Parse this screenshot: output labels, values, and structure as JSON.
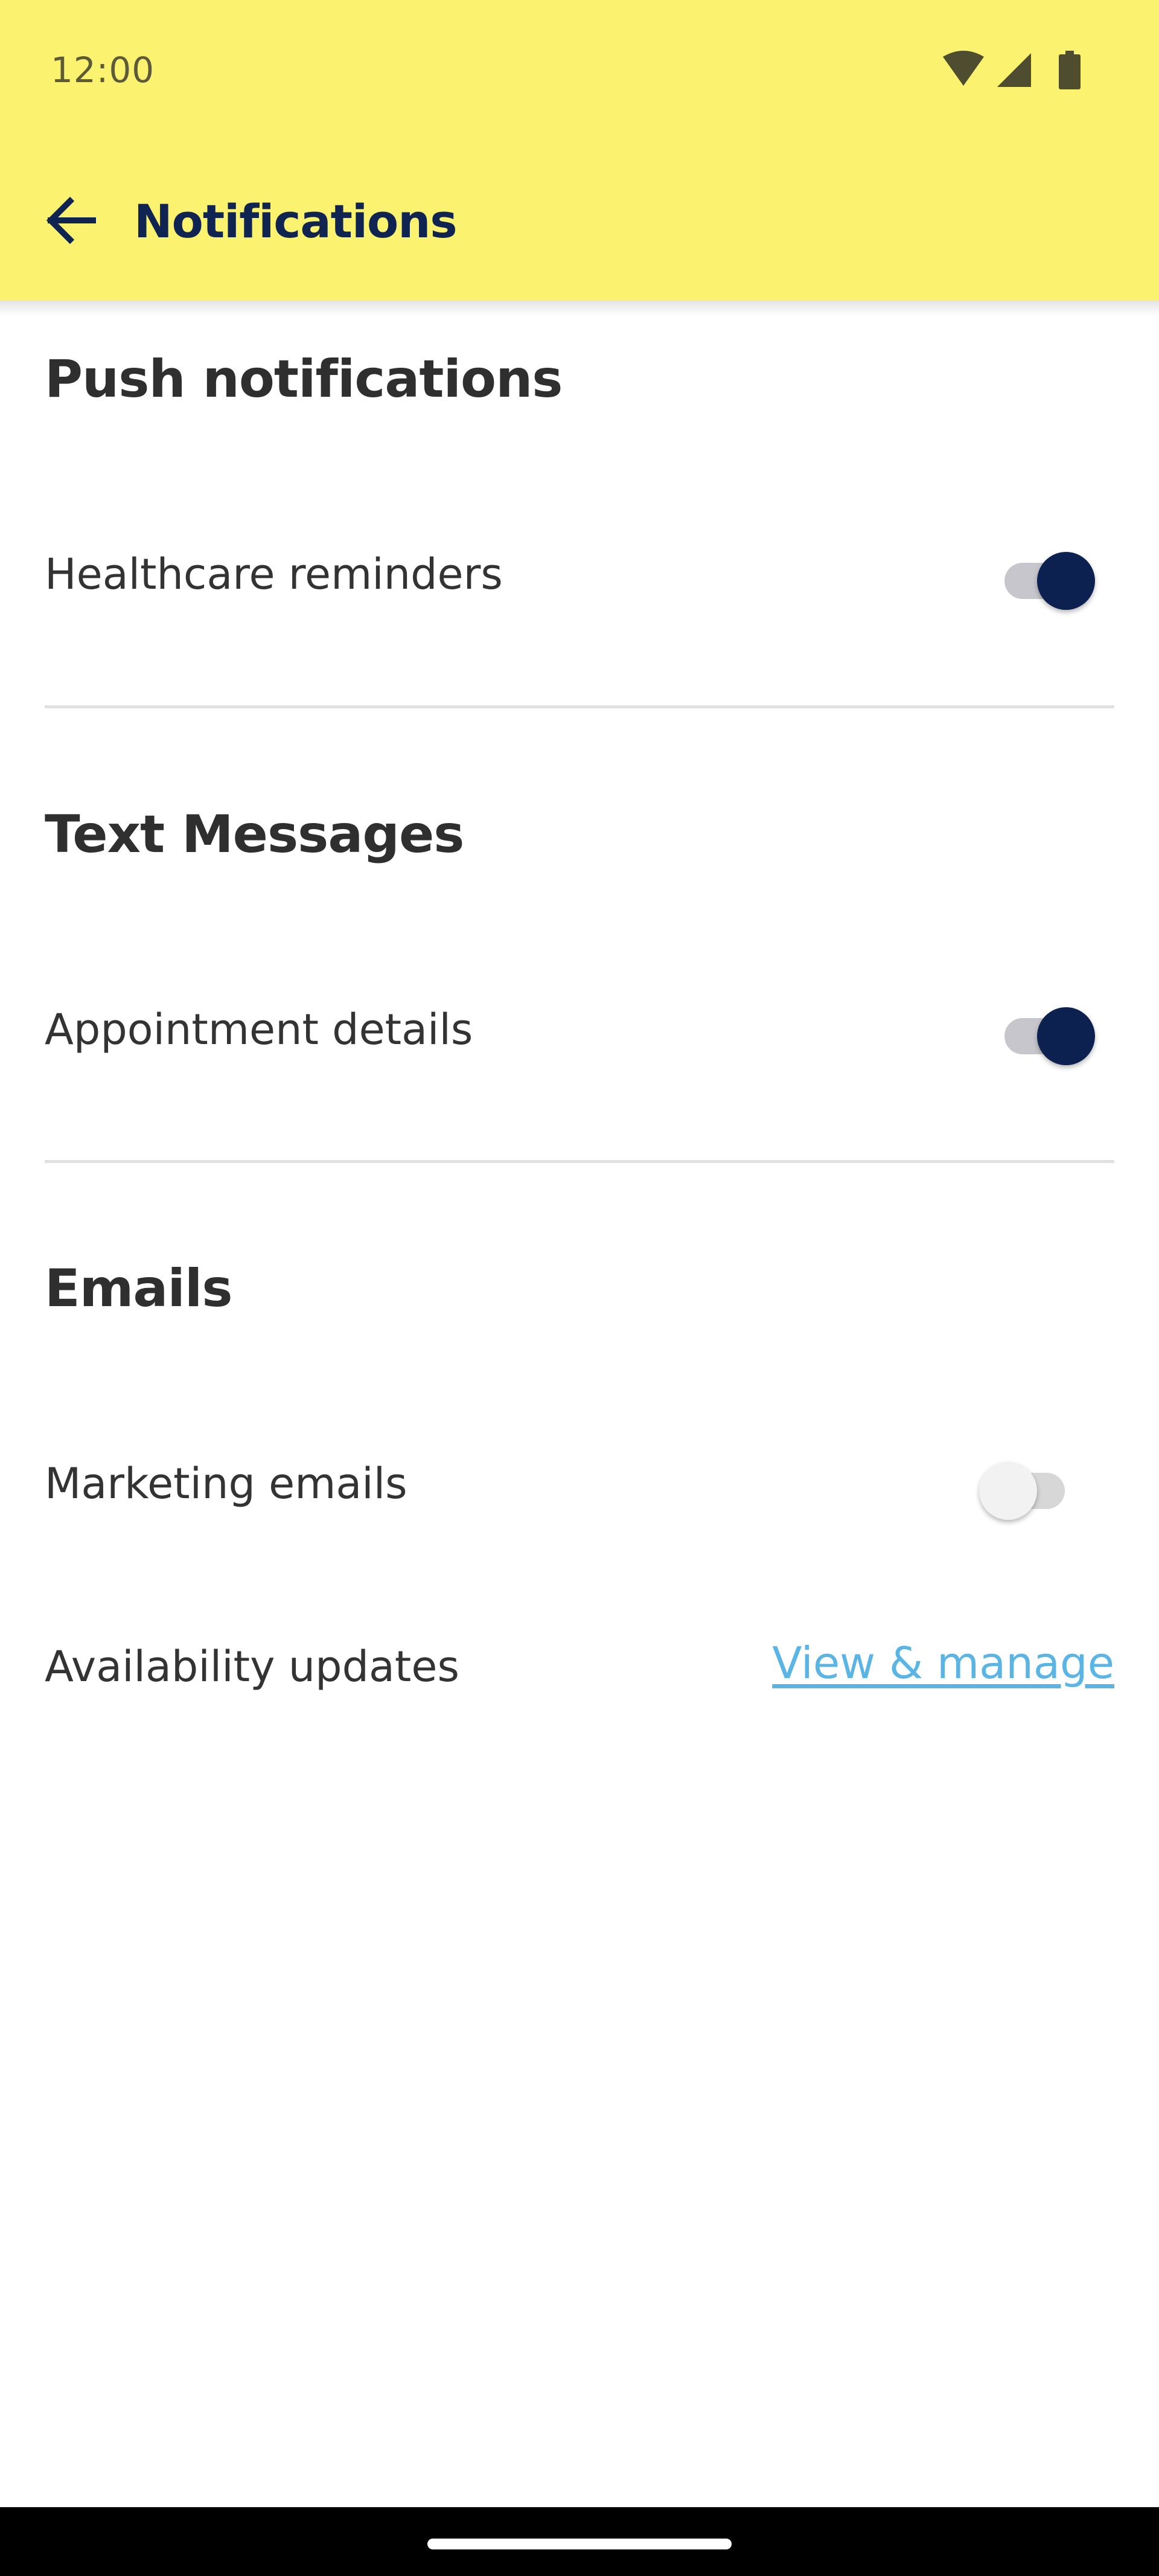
{
  "status_bar": {
    "time": "12:00",
    "icons": [
      "wifi-icon",
      "cellular-signal-icon",
      "battery-icon"
    ]
  },
  "header": {
    "title": "Notifications",
    "back_icon": "arrow-left-icon"
  },
  "sections": [
    {
      "title": "Push notifications",
      "rows": [
        {
          "label": "Healthcare reminders",
          "control": "toggle",
          "enabled": true
        }
      ]
    },
    {
      "title": "Text Messages",
      "rows": [
        {
          "label": "Appointment details",
          "control": "toggle",
          "enabled": true
        }
      ]
    },
    {
      "title": "Emails",
      "rows": [
        {
          "label": "Marketing emails",
          "control": "toggle",
          "enabled": false
        },
        {
          "label": "Availability updates",
          "control": "link",
          "link_label": "View & manage"
        }
      ]
    }
  ],
  "colors": {
    "appbar_background": "#fbf270",
    "title_navy": "#0f2451",
    "toggle_on_thumb": "#0d2150",
    "link_blue": "#5ab5e5"
  }
}
